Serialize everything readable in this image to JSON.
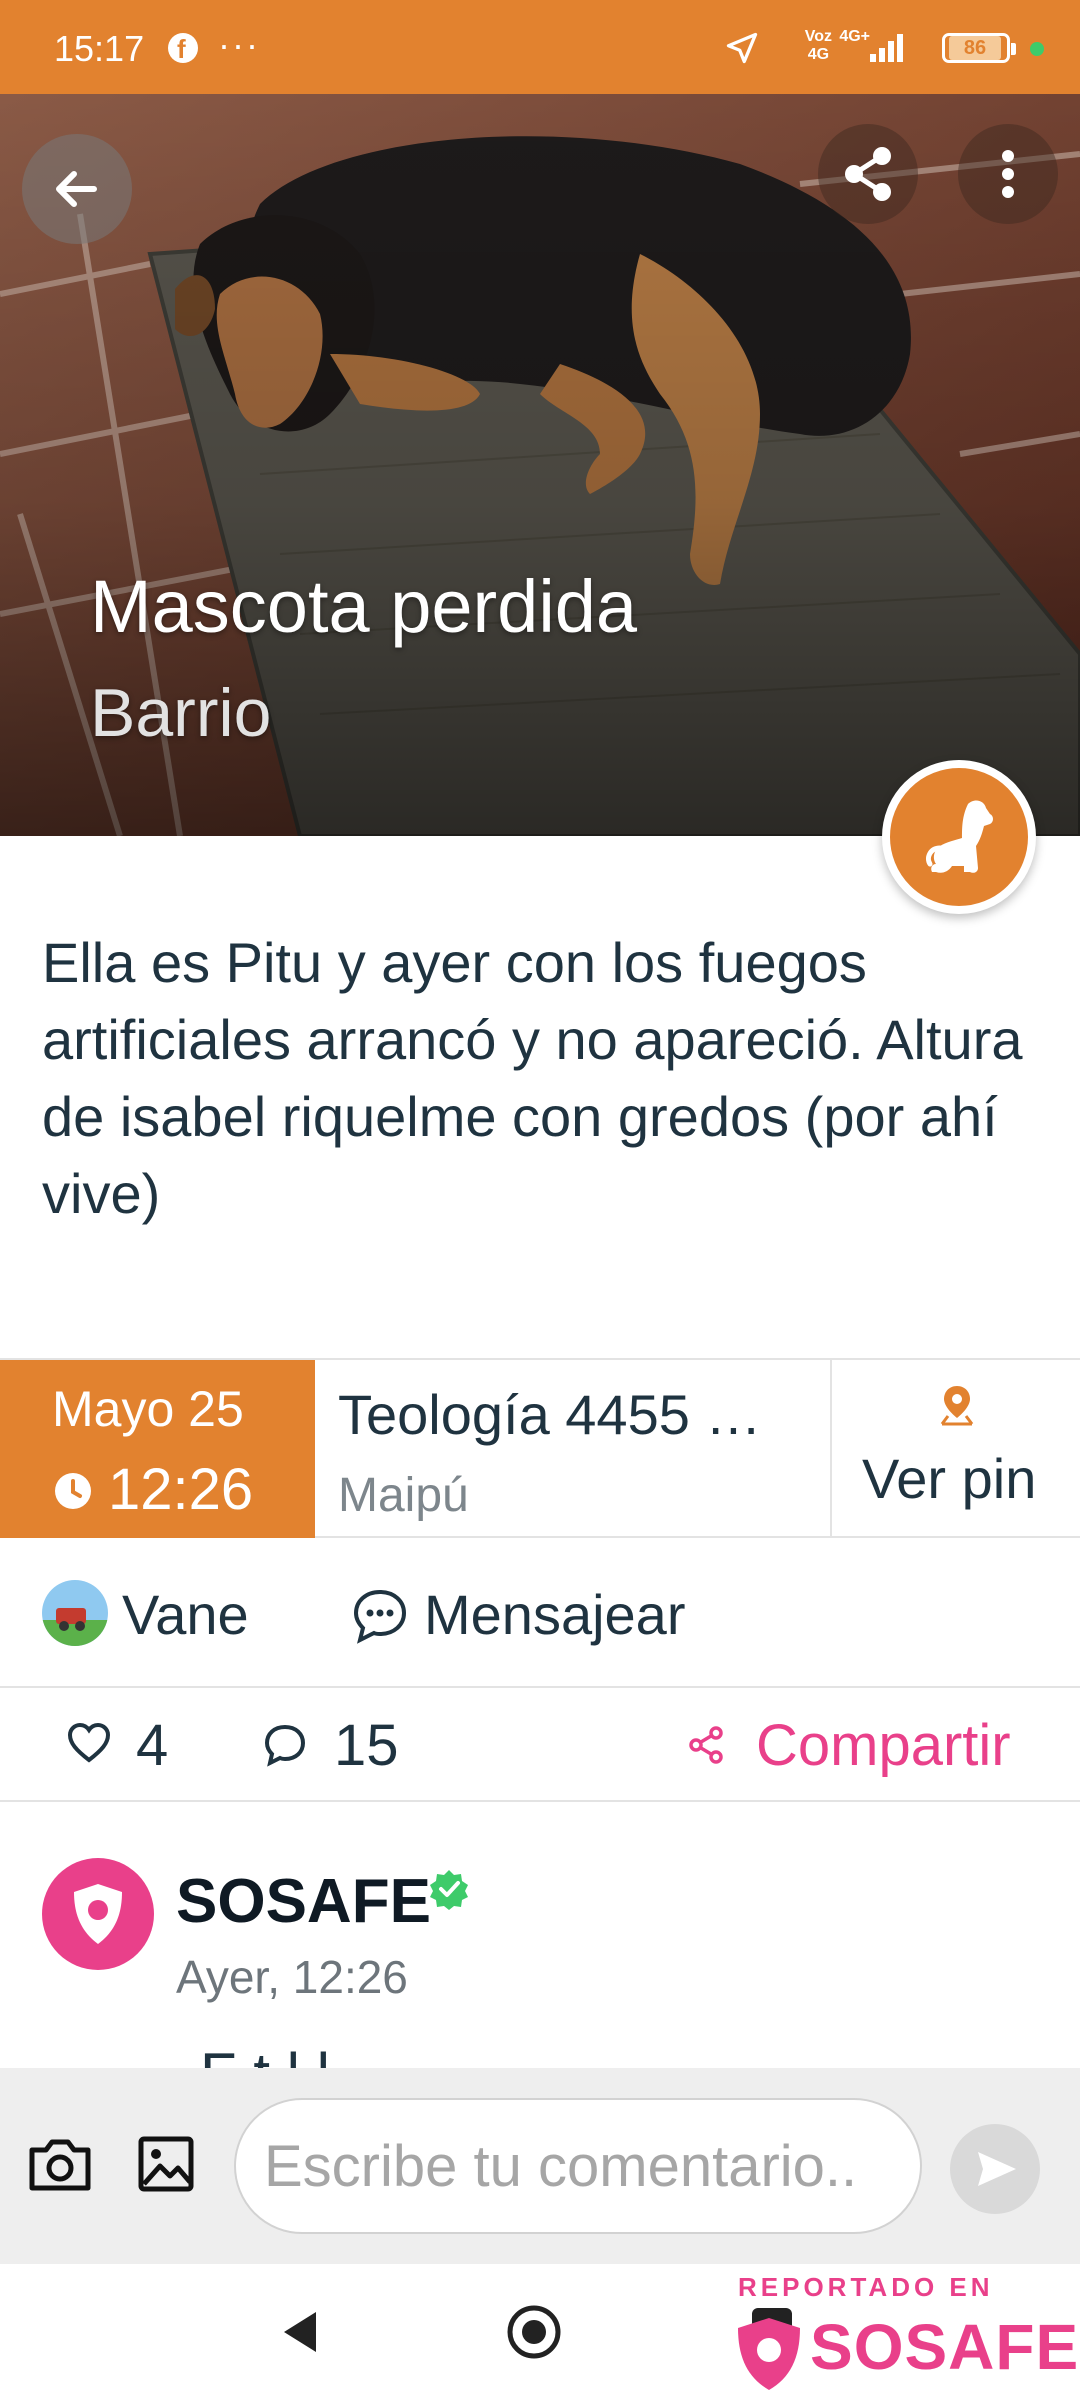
{
  "status_bar": {
    "time": "15:17",
    "dots": "···",
    "network_voz": "Voz",
    "network_4g": "4G",
    "network_lte": "4G+",
    "battery": "86"
  },
  "hero": {
    "title": "Mascota perdida",
    "subtitle": "Barrio",
    "category_icon": "dog-icon"
  },
  "post": {
    "description": "Ella es Pitu y ayer con los fuegos artificiales arrancó y no apareció. Altura de isabel riquelme con gredos (por ahí vive)"
  },
  "info": {
    "date": "Mayo 25",
    "time": "12:26",
    "address": "Teología  4455 …",
    "commune": "Maipú",
    "pin_label": "Ver pin"
  },
  "author": {
    "name": "Vane",
    "message_label": "Mensajear"
  },
  "stats": {
    "likes": "4",
    "comments": "15",
    "share_label": "Compartir"
  },
  "comment": {
    "author": "SOSAFE",
    "time": "Ayer, 12:26",
    "peek": "F       t     l                    l"
  },
  "composer": {
    "placeholder": "Escribe tu comentario.."
  },
  "watermark": {
    "label": "REPORTADO EN",
    "brand": "SOSAFE"
  },
  "colors": {
    "accent_orange": "#e2822f",
    "brand_pink": "#e9408a",
    "text_dark": "#1f3340"
  }
}
